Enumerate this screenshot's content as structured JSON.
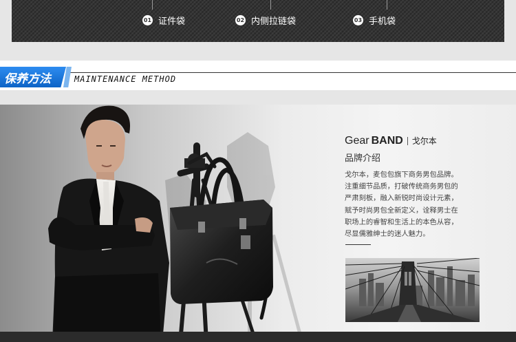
{
  "features": [
    {
      "num": "01",
      "label": "证件袋"
    },
    {
      "num": "02",
      "label": "内侧拉链袋"
    },
    {
      "num": "03",
      "label": "手机袋"
    }
  ],
  "section": {
    "title_cn": "保养方法",
    "title_en": "MAINTENANCE METHOD",
    "accent_color": "#1a73d6"
  },
  "brand": {
    "name_light": "Gear",
    "name_bold": "BAND",
    "name_cn": "戈尔本",
    "intro_title": "品牌介绍",
    "description": [
      "戈尔本，麦包包旗下商务男包品牌。",
      "注重细节品质，打破传统商务男包的",
      "严肃刻板，融入新锐时尚设计元素，",
      "赋予时尚男包全新定义，诠释男士在",
      "职场上的睿智和生活上的本色从容，",
      "尽显儒雅绅士的迷人魅力。"
    ]
  }
}
